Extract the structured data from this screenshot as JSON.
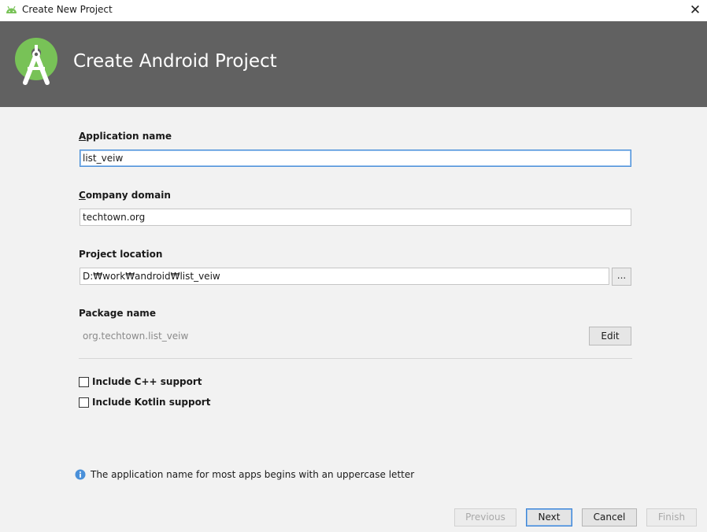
{
  "window": {
    "title": "Create New Project",
    "close_glyph": "✕"
  },
  "header": {
    "title": "Create Android Project",
    "logo_icon": "android-studio-logo-icon",
    "accent_color": "#78c257"
  },
  "form": {
    "app_name": {
      "label_first": "A",
      "label_rest": "pplication name",
      "value": "list_veiw"
    },
    "company_domain": {
      "label_first": "C",
      "label_rest": "ompany domain",
      "value": "techtown.org"
    },
    "project_location": {
      "label": "Project location",
      "value": "D:₩work₩android₩list_veiw",
      "browse_label": "..."
    },
    "package_name": {
      "label": "Package name",
      "value": "org.techtown.list_veiw",
      "edit_label": "Edit"
    }
  },
  "options": [
    {
      "label": "Include C++ support",
      "checked": false
    },
    {
      "label": "Include Kotlin support",
      "checked": false
    }
  ],
  "info": {
    "icon": "info-icon",
    "text": "The application name for most apps begins with an uppercase letter"
  },
  "buttons": {
    "previous": "Previous",
    "next": "Next",
    "cancel": "Cancel",
    "finish": "Finish"
  }
}
